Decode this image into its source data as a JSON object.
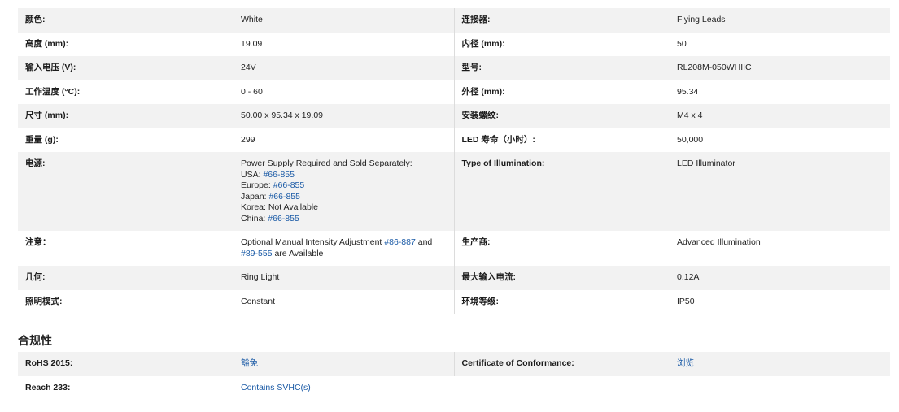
{
  "specs": [
    {
      "l1": "颜色:",
      "v1": "White",
      "l2": "连接器:",
      "v2": "Flying Leads"
    },
    {
      "l1": "高度 (mm):",
      "v1": "19.09",
      "l2": "内径 (mm):",
      "v2": "50"
    },
    {
      "l1": "输入电压 (V):",
      "v1": "24V",
      "l2": "型号:",
      "v2": "RL208M-050WHIIC"
    },
    {
      "l1": "工作温度 (°C):",
      "v1": "0 - 60",
      "l2": "外径 (mm):",
      "v2": "95.34"
    },
    {
      "l1": "尺寸 (mm):",
      "v1": "50.00 x 95.34 x 19.09",
      "l2": "安装螺纹:",
      "v2": "M4 x 4"
    },
    {
      "l1": "重量 (g):",
      "v1": "299",
      "l2": "LED 寿命（小时）:",
      "v2": "50,000"
    }
  ],
  "power": {
    "label": "电源:",
    "line1": "Power Supply Required and Sold Separately:",
    "usa_label": "USA: ",
    "usa_link": "#66-855",
    "eu_label": "Europe: ",
    "eu_link": "#66-855",
    "jp_label": "Japan: ",
    "jp_link": "#66-855",
    "kr": "Korea: Not Available",
    "cn_label": "China: ",
    "cn_link": "#66-855",
    "type_label": "Type of Illumination:",
    "type_value": "LED Illuminator"
  },
  "note": {
    "label": "注意：",
    "pre": "Optional Manual Intensity Adjustment ",
    "link1": "#86-887",
    "mid": " and ",
    "link2": "#89-555",
    "post": " are Available",
    "mfr_label": "生产商:",
    "mfr_value": "Advanced Illumination"
  },
  "specs2": [
    {
      "l1": "几何:",
      "v1": "Ring Light",
      "l2": "最大输入电流:",
      "v2": "0.12A"
    },
    {
      "l1": "照明模式:",
      "v1": "Constant",
      "l2": "环境等级:",
      "v2": "IP50"
    }
  ],
  "compliance": {
    "title": "合规性",
    "rohs_label": "RoHS 2015:",
    "rohs_value": "豁免",
    "coc_label": "Certificate of Conformance:",
    "coc_value": "浏览",
    "reach_label": "Reach 233:",
    "reach_value": "Contains SVHC(s)"
  }
}
